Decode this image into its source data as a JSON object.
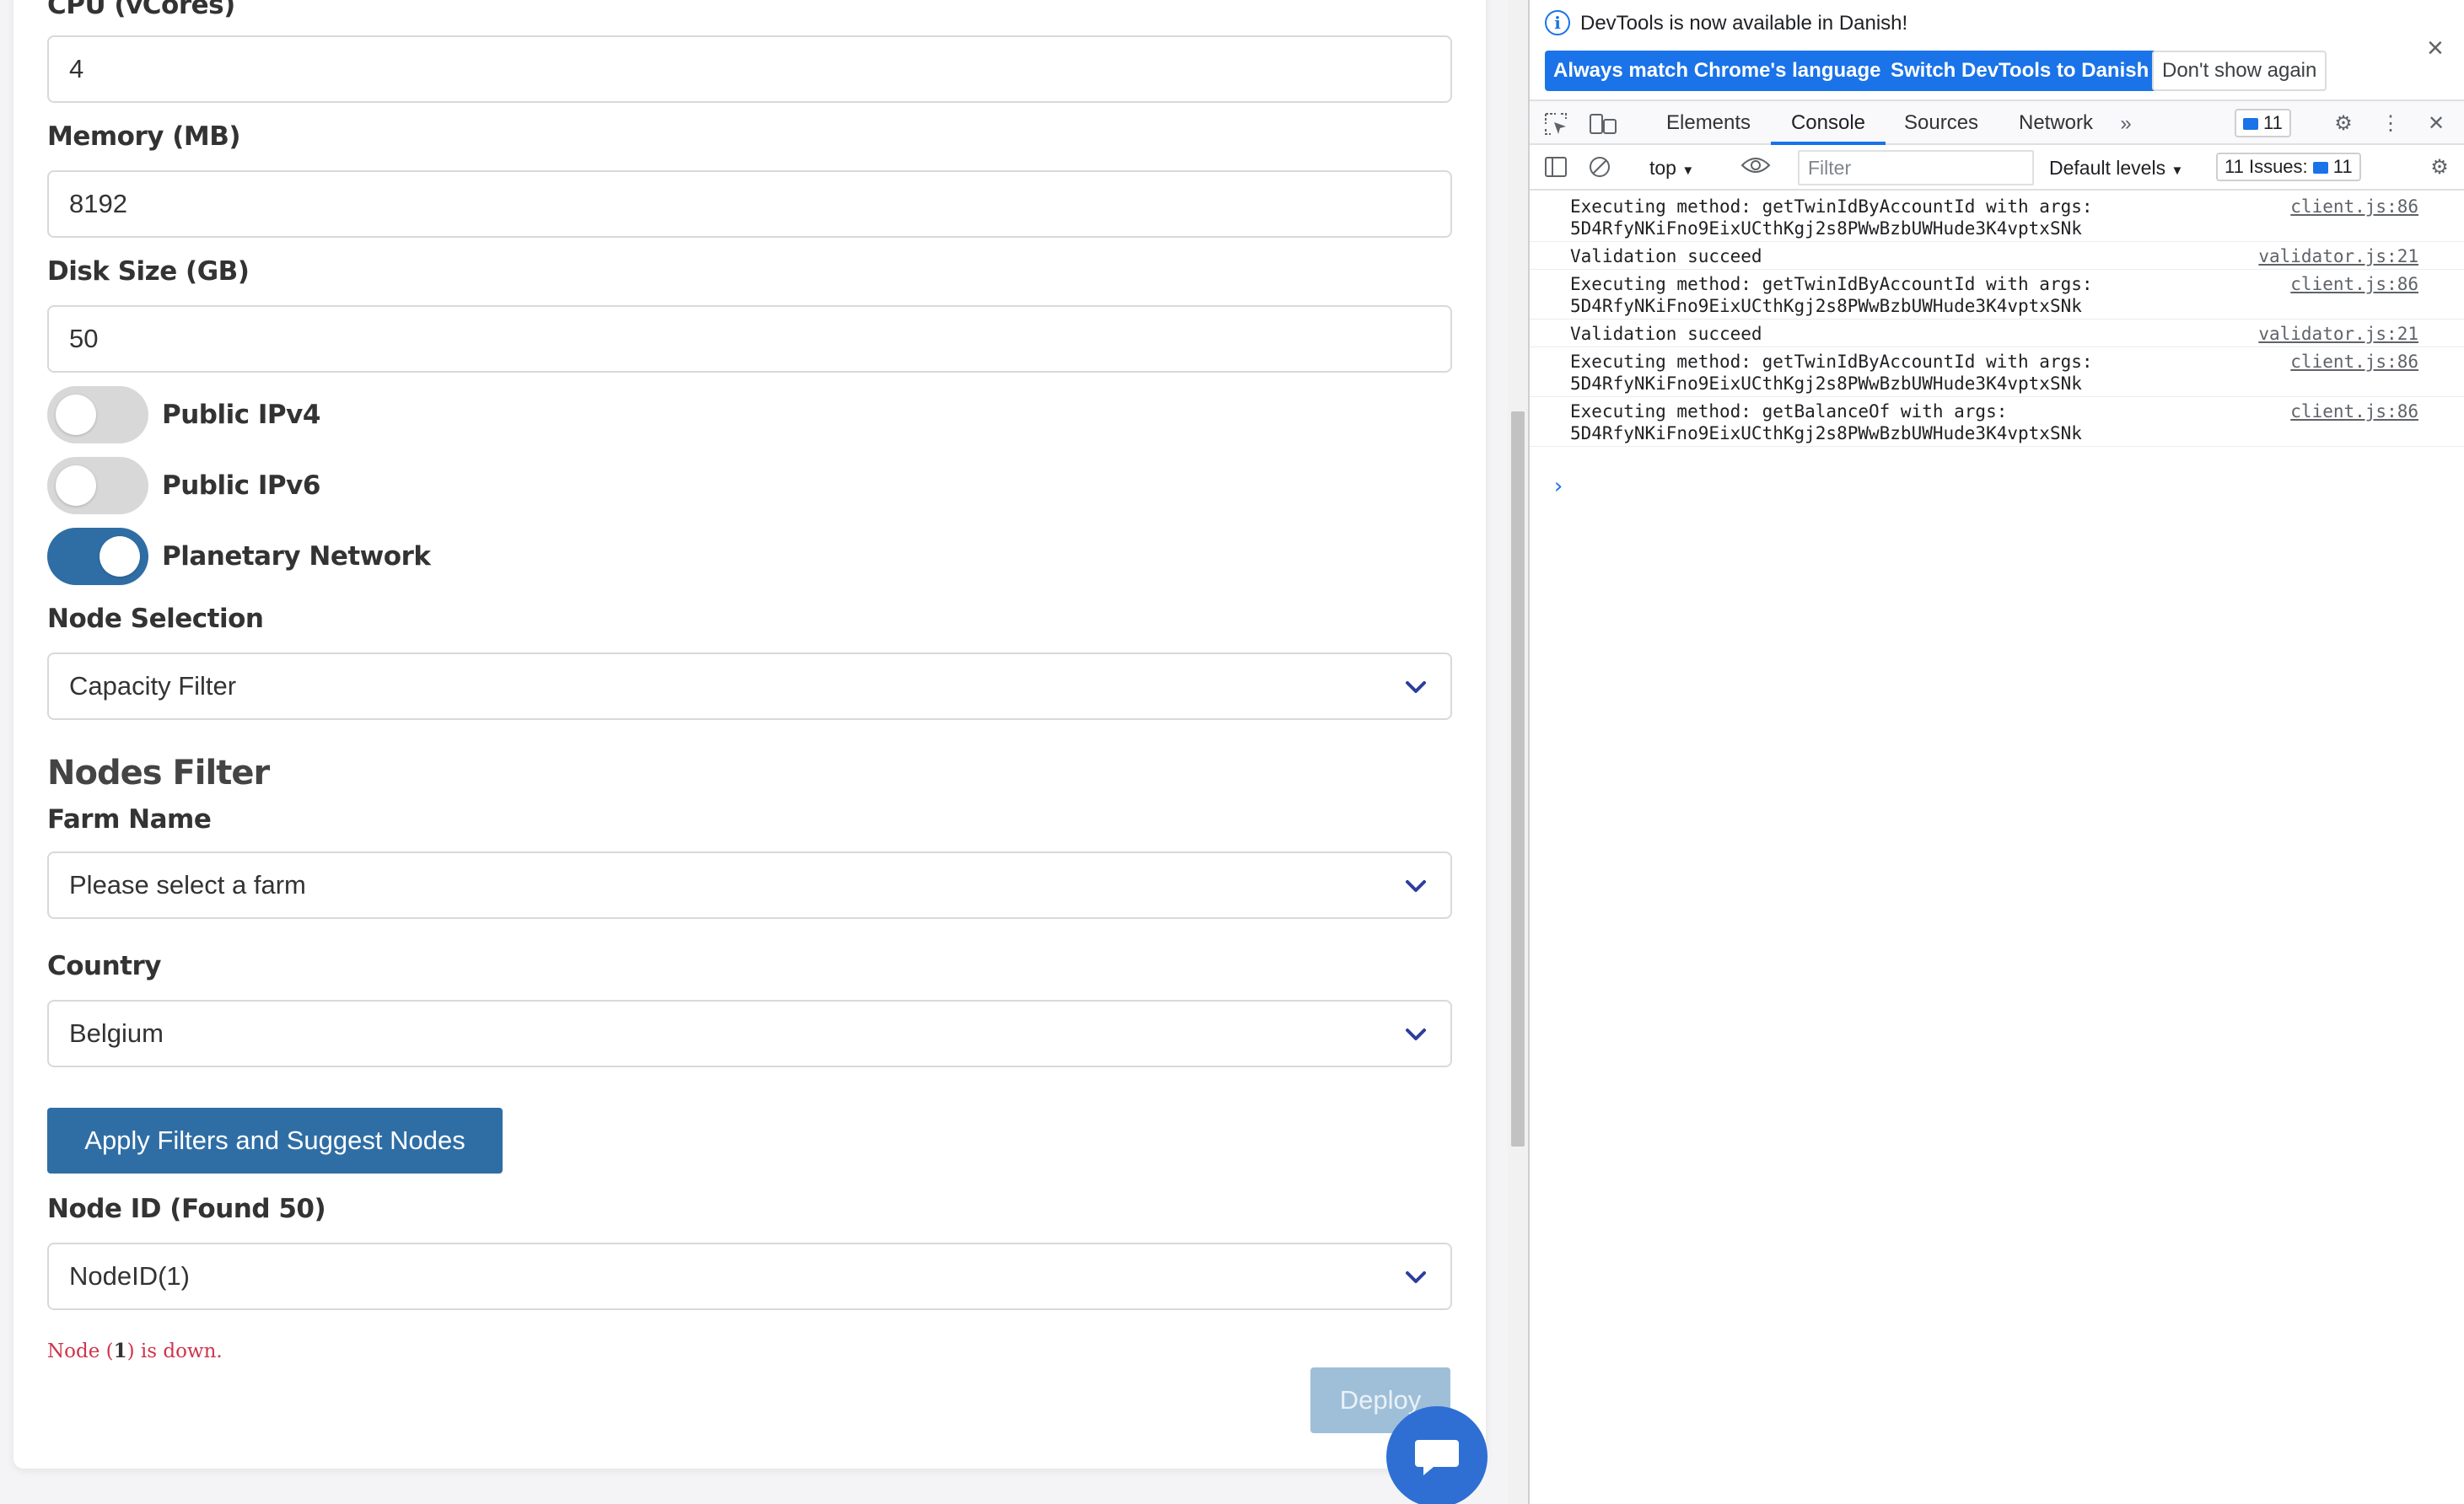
{
  "form": {
    "cpu_label": "CPU (vCores)",
    "cpu_value": "4",
    "memory_label": "Memory (MB)",
    "memory_value": "8192",
    "disk_label": "Disk Size (GB)",
    "disk_value": "50",
    "toggles": [
      {
        "label": "Public IPv4",
        "on": false
      },
      {
        "label": "Public IPv6",
        "on": false
      },
      {
        "label": "Planetary Network",
        "on": true
      }
    ],
    "node_selection_label": "Node Selection",
    "node_selection_value": "Capacity Filter",
    "nodes_filter_heading": "Nodes Filter",
    "farm_name_label": "Farm Name",
    "farm_name_value": "Please select a farm",
    "country_label": "Country",
    "country_value": "Belgium",
    "apply_button": "Apply Filters and Suggest Nodes",
    "node_id_label": "Node ID (Found 50)",
    "node_id_value": "NodeID(1)",
    "error_prefix": "Node (",
    "error_node": "1",
    "error_suffix": ") is down.",
    "deploy_button": "Deploy"
  },
  "colors": {
    "primary": "#2f6ea5",
    "deploy_disabled": "#9fbfd9",
    "error": "#d0344c",
    "chat": "#2f6fd4",
    "devtools_blue": "#1a73e8"
  },
  "devtools": {
    "banner_text": "DevTools is now available in Danish!",
    "banner_buttons": [
      "Always match Chrome's language",
      "Switch DevTools to Danish",
      "Don't show again"
    ],
    "tabs": [
      "Elements",
      "Console",
      "Sources",
      "Network"
    ],
    "active_tab": "Console",
    "issues_count": "11",
    "context": "top",
    "filter_placeholder": "Filter",
    "levels": "Default levels",
    "issues_label": "11 Issues:",
    "issues_badge": "11",
    "logs": [
      {
        "line1": "Executing method: getTwinIdByAccountId with args:",
        "line2": "5D4RfyNKiFno9EixUCthKgj2s8PWwBzbUWHude3K4vptxSNk",
        "source": "client.js:86"
      },
      {
        "line1": "Validation succeed",
        "line2": "",
        "source": "validator.js:21"
      },
      {
        "line1": "Executing method: getTwinIdByAccountId with args:",
        "line2": "5D4RfyNKiFno9EixUCthKgj2s8PWwBzbUWHude3K4vptxSNk",
        "source": "client.js:86"
      },
      {
        "line1": "Validation succeed",
        "line2": "",
        "source": "validator.js:21"
      },
      {
        "line1": "Executing method: getTwinIdByAccountId with args:",
        "line2": "5D4RfyNKiFno9EixUCthKgj2s8PWwBzbUWHude3K4vptxSNk",
        "source": "client.js:86"
      },
      {
        "line1": "Executing method: getBalanceOf with args:",
        "line2": "5D4RfyNKiFno9EixUCthKgj2s8PWwBzbUWHude3K4vptxSNk",
        "source": "client.js:86"
      }
    ],
    "prompt": "›"
  }
}
